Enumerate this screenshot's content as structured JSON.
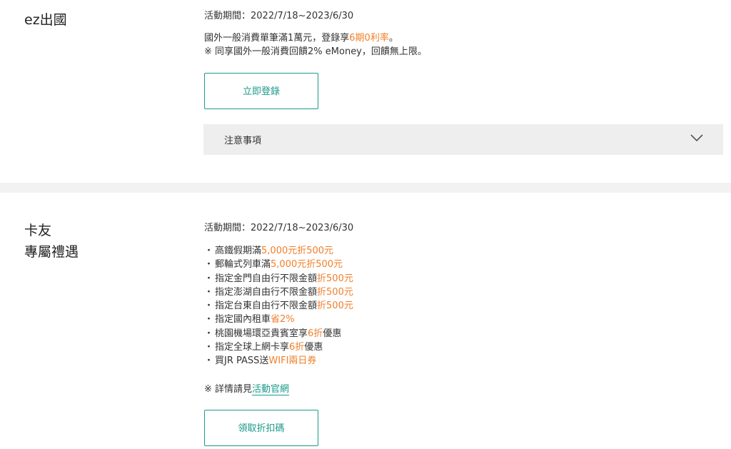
{
  "section1": {
    "title": "ez出國",
    "period": "活動期間：2022/7/18~2023/6/30",
    "line1_prefix": "國外一般消費單筆滿1萬元，登錄享",
    "line1_highlight": "6期0利率",
    "line1_suffix": "。",
    "line2": "※ 同享國外一般消費回饋2% eMoney，回饋無上限。",
    "button_label": "立即登錄",
    "accordion_label": "注意事項"
  },
  "section2": {
    "title_line1": "卡友",
    "title_line2": "專屬禮遇",
    "period": "活動期間：2022/7/18~2023/6/30",
    "bullets": [
      {
        "dot": "・",
        "text": "高鐵假期滿",
        "highlight": "5,000元折500元",
        "tail": ""
      },
      {
        "dot": "・",
        "text": "郵輪式列車滿",
        "highlight": "5,000元折500元",
        "tail": ""
      },
      {
        "dot": "・",
        "text": "指定金門自由行不限金額",
        "highlight": "折500元",
        "tail": ""
      },
      {
        "dot": "・",
        "text": "指定澎湖自由行不限金額",
        "highlight": "折500元",
        "tail": ""
      },
      {
        "dot": "・",
        "text": "指定台東自由行不限金額",
        "highlight": "折500元",
        "tail": ""
      },
      {
        "dot": "・",
        "text": "指定國內租車",
        "highlight": "省2%",
        "tail": ""
      },
      {
        "dot": "・",
        "text": "桃園機場環亞貴賓室享",
        "highlight": "6折",
        "tail": "優惠"
      },
      {
        "dot": "・",
        "text": "指定全球上網卡享",
        "highlight": "6折",
        "tail": "優惠"
      },
      {
        "dot": "・",
        "text": "買JR PASS送",
        "highlight": "WIFI兩日券",
        "tail": ""
      }
    ],
    "note_prefix": "※ 詳情請見",
    "note_link": "活動官網",
    "button_label": "領取折扣碼"
  },
  "colors": {
    "accent": "#1a9a8a",
    "highlight": "#f07e2a",
    "band": "#f2f2f2",
    "accordion_bg": "#eeeeee"
  }
}
